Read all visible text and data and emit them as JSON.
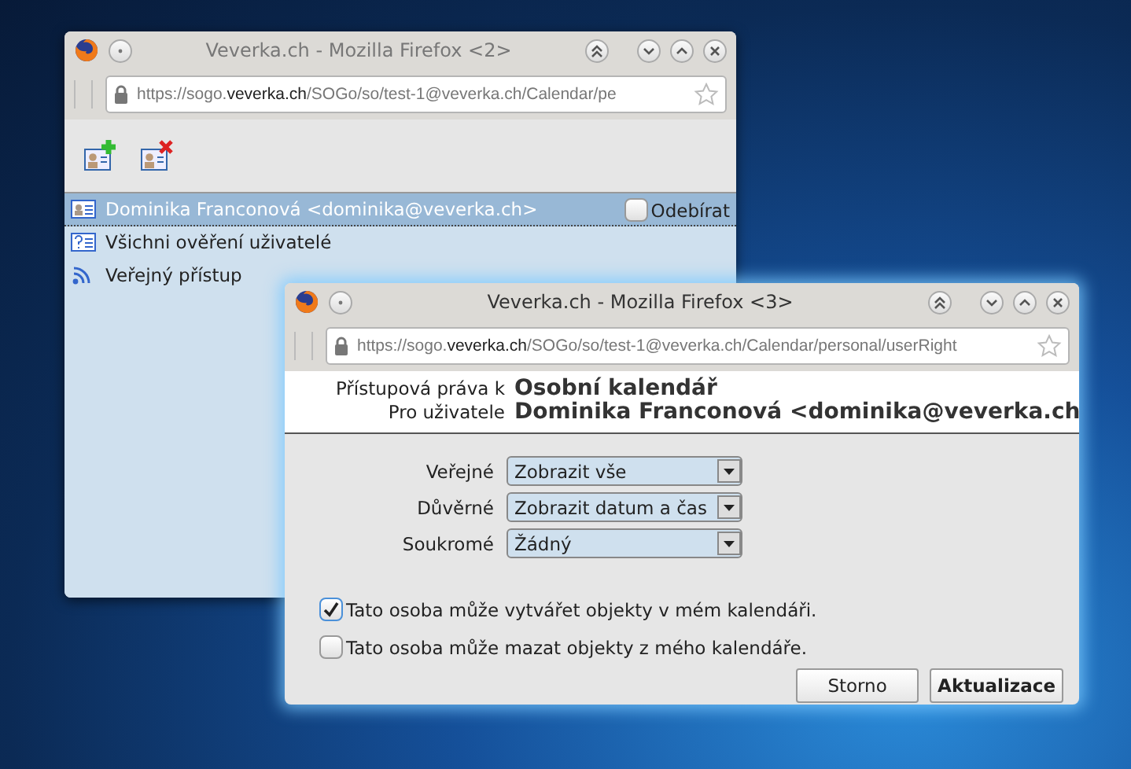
{
  "back_window": {
    "title": "Veverka.ch - Mozilla Firefox <2>",
    "url": "https://sogo.**veverka.ch**/SOGo/so/test-1@veverka.ch/Calendar/pe",
    "users": [
      {
        "kind": "user",
        "label": "Dominika Franconová <dominika@veverka.ch>",
        "selected": true
      },
      {
        "kind": "group",
        "label": "Všichni ověření uživatelé",
        "selected": false
      },
      {
        "kind": "public",
        "label": "Veřejný přístup",
        "selected": false
      }
    ],
    "subscribe": {
      "label": "Odebírat",
      "checked": false
    }
  },
  "front_window": {
    "title": "Veverka.ch - Mozilla Firefox <3>",
    "url": "https://sogo.**veverka.ch**/SOGo/so/test-1@veverka.ch/Calendar/personal/userRight",
    "header": [
      {
        "label": "Přístupová práva k",
        "value": "Osobní kalendář"
      },
      {
        "label": "Pro uživatele",
        "value": "Dominika Franconová <dominika@veverka.ch"
      }
    ],
    "rights": [
      {
        "label": "Veřejné",
        "value": "Zobrazit vše"
      },
      {
        "label": "Důvěrné",
        "value": "Zobrazit datum a čas"
      },
      {
        "label": "Soukromé",
        "value": "Žádný"
      }
    ],
    "permissions": [
      {
        "label": "Tato osoba může vytvářet objekty v mém kalendáři.",
        "checked": true
      },
      {
        "label": "Tato osoba může mazat objekty z mého kalendáře.",
        "checked": false
      }
    ],
    "buttons": [
      {
        "label": "Storno",
        "primary": false
      },
      {
        "label": "Aktualizace",
        "primary": true
      }
    ]
  }
}
